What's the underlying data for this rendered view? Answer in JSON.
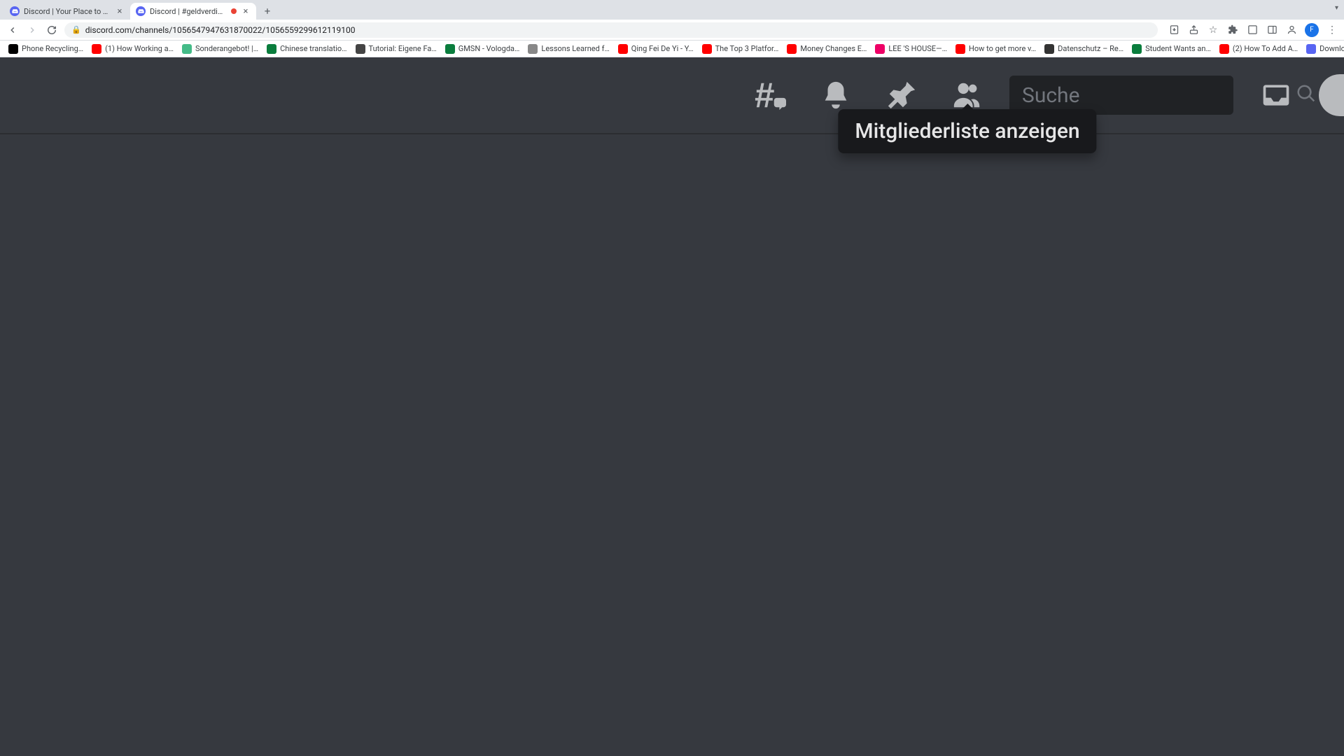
{
  "browser": {
    "tabs": [
      {
        "title": "Discord | Your Place to Talk a…",
        "active": false,
        "recording": false
      },
      {
        "title": "Discord | #geldverdienen",
        "active": true,
        "recording": true
      }
    ],
    "url": "discord.com/channels/1056547947631870022/1056559299612119100",
    "bookmarks": [
      {
        "label": "Phone Recycling…",
        "color": "#000"
      },
      {
        "label": "(1) How Working a…",
        "color": "#f00"
      },
      {
        "label": "Sonderangebot! |…",
        "color": "#4b8"
      },
      {
        "label": "Chinese translatio…",
        "color": "#0a7d3d"
      },
      {
        "label": "Tutorial: Eigene Fa…",
        "color": "#444"
      },
      {
        "label": "GMSN - Vologda…",
        "color": "#0a7d3d"
      },
      {
        "label": "Lessons Learned f…",
        "color": "#888"
      },
      {
        "label": "Qing Fei De Yi - Y…",
        "color": "#f00"
      },
      {
        "label": "The Top 3 Platfor…",
        "color": "#f00"
      },
      {
        "label": "Money Changes E…",
        "color": "#f00"
      },
      {
        "label": "LEE 'S HOUSE—…",
        "color": "#e06"
      },
      {
        "label": "How to get more v…",
        "color": "#f00"
      },
      {
        "label": "Datenschutz – Re…",
        "color": "#333"
      },
      {
        "label": "Student Wants an…",
        "color": "#0a7d3d"
      },
      {
        "label": "(2) How To Add A…",
        "color": "#f00"
      },
      {
        "label": "Download – Cooki…",
        "color": "#5865f2"
      }
    ]
  },
  "discord": {
    "search_placeholder": "Suche",
    "tooltip_members": "Mitgliederliste anzeigen"
  }
}
